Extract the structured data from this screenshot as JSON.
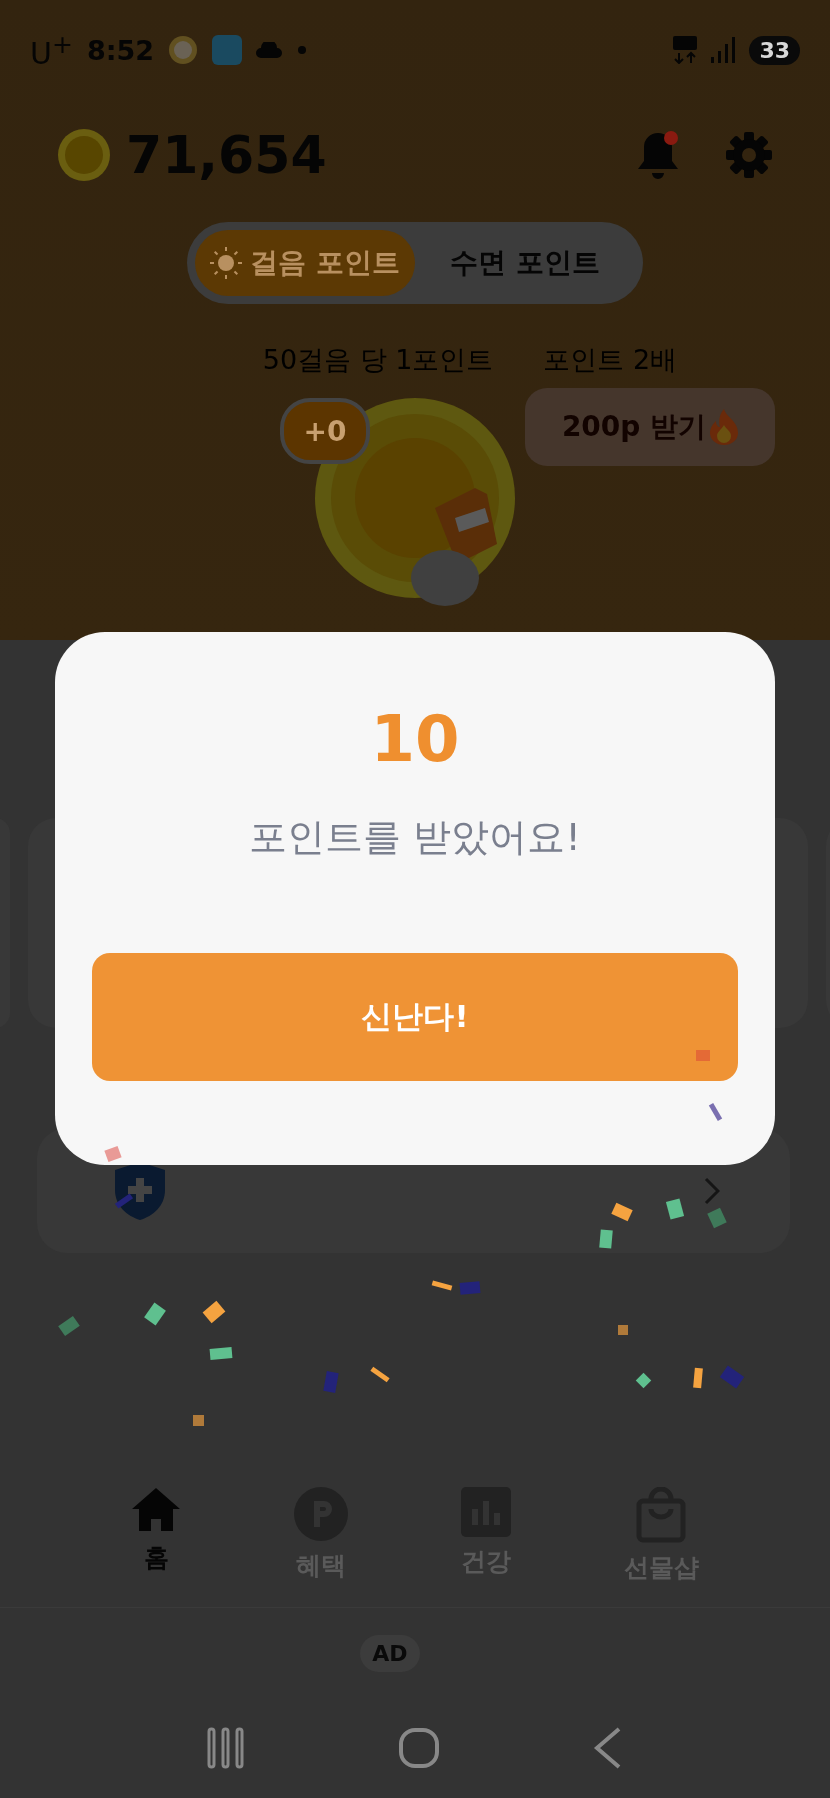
{
  "status_bar": {
    "carrier": "U$^{+}$",
    "time": "8:52",
    "battery": "33"
  },
  "header": {
    "points": "71,654",
    "has_new_notification": true
  },
  "mode_tabs": [
    {
      "label": "걸음 포인트",
      "selected": true
    },
    {
      "label": "수면 포인트",
      "selected": false
    }
  ],
  "rate_info": [
    "50걸음 당 1포인트",
    "포인트 2배"
  ],
  "reward": {
    "gained": "+0",
    "claim_button": "200p 받기"
  },
  "modal": {
    "amount": "10",
    "message": "포인트를 받았어요!",
    "confirm_button": "신난다!"
  },
  "bottom_nav": [
    {
      "label": "홈",
      "selected": true
    },
    {
      "label": "혜택",
      "selected": false
    },
    {
      "label": "건강",
      "selected": false
    },
    {
      "label": "선물샵",
      "selected": false
    }
  ],
  "ad_label": "AD"
}
